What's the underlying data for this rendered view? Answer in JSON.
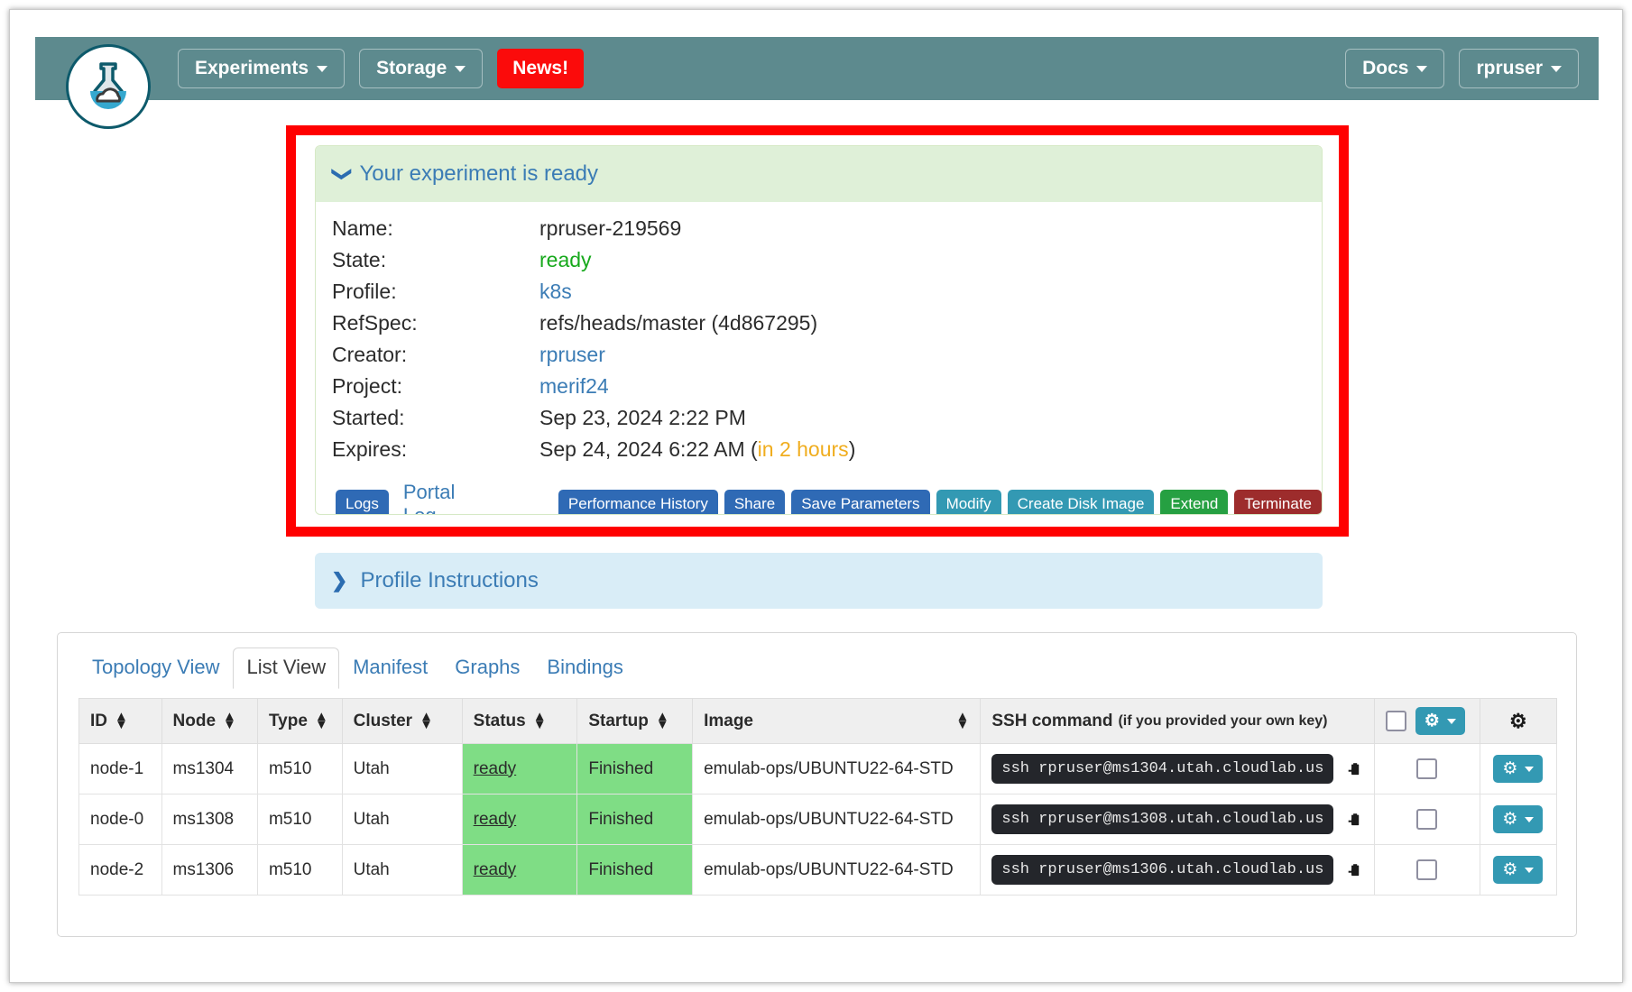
{
  "navbar": {
    "logo_name": "cloudlab-flask-logo",
    "left_items": [
      {
        "label": "Experiments",
        "caret": true,
        "style": "plain"
      },
      {
        "label": "Storage",
        "caret": true,
        "style": "plain"
      },
      {
        "label": "News!",
        "caret": false,
        "style": "news"
      }
    ],
    "right_items": [
      {
        "label": "Docs",
        "caret": true
      },
      {
        "label": "rpruser",
        "caret": true
      }
    ],
    "background_color": "#5d8a8e",
    "news_color": "#fb0b0b"
  },
  "status_panel": {
    "header_title": "Your experiment is ready",
    "header_color": "#dff0d8",
    "collapse_icon": "chevron-down-icon",
    "fields": [
      {
        "key": "Name:",
        "value": "rpruser-219569",
        "style": "plain"
      },
      {
        "key": "State:",
        "value": "ready",
        "style": "green"
      },
      {
        "key": "Profile:",
        "value": "k8s",
        "style": "link"
      },
      {
        "key": "RefSpec:",
        "value": "refs/heads/master (4d867295)",
        "style": "plain"
      },
      {
        "key": "Creator:",
        "value": "rpruser",
        "style": "link"
      },
      {
        "key": "Project:",
        "value": "merif24",
        "style": "link"
      },
      {
        "key": "Started:",
        "value": "Sep 23, 2024 2:22 PM",
        "style": "plain"
      }
    ],
    "expires": {
      "key": "Expires:",
      "value": "Sep 24, 2024 6:22 AM (",
      "remaining": "in 2 hours",
      "suffix": ")",
      "remaining_color": "#f0ad1e"
    },
    "buttons": {
      "logs": "Logs",
      "portal_log": "Portal Log",
      "performance_history": "Performance History",
      "share": "Share",
      "save_parameters": "Save Parameters",
      "modify": "Modify",
      "create_disk_image": "Create Disk Image",
      "extend": "Extend",
      "terminate": "Terminate"
    }
  },
  "annotation": {
    "name": "red-highlight-box",
    "color": "#ff0000"
  },
  "profile_instructions": {
    "title": "Profile Instructions",
    "expand_icon": "chevron-right-icon",
    "background_color": "#d9edf7"
  },
  "list_panel": {
    "tabs": [
      {
        "label": "Topology View",
        "active": false
      },
      {
        "label": "List View",
        "active": true
      },
      {
        "label": "Manifest",
        "active": false
      },
      {
        "label": "Graphs",
        "active": false
      },
      {
        "label": "Bindings",
        "active": false
      }
    ],
    "table": {
      "columns": [
        {
          "label": "ID",
          "sortable": true
        },
        {
          "label": "Node",
          "sortable": true
        },
        {
          "label": "Type",
          "sortable": true
        },
        {
          "label": "Cluster",
          "sortable": true
        },
        {
          "label": "Status",
          "sortable": true
        },
        {
          "label": "Startup",
          "sortable": true
        },
        {
          "label": "Image",
          "sortable": true
        }
      ],
      "ssh_column": {
        "label": "SSH command",
        "note": "(if you provided your own key)"
      },
      "rows": [
        {
          "id": "node-1",
          "node": "ms1304",
          "type": "m510",
          "cluster": "Utah",
          "status": "ready",
          "startup": "Finished",
          "image": "emulab-ops/UBUNTU22-64-STD",
          "ssh": "ssh rpruser@ms1304.utah.cloudlab.us"
        },
        {
          "id": "node-0",
          "node": "ms1308",
          "type": "m510",
          "cluster": "Utah",
          "status": "ready",
          "startup": "Finished",
          "image": "emulab-ops/UBUNTU22-64-STD",
          "ssh": "ssh rpruser@ms1308.utah.cloudlab.us"
        },
        {
          "id": "node-2",
          "node": "ms1306",
          "type": "m510",
          "cluster": "Utah",
          "status": "ready",
          "startup": "Finished",
          "image": "emulab-ops/UBUNTU22-64-STD",
          "ssh": "ssh rpruser@ms1306.utah.cloudlab.us"
        }
      ],
      "status_ok_color": "#7fdd85",
      "gear_button_color": "#3399b3"
    }
  }
}
